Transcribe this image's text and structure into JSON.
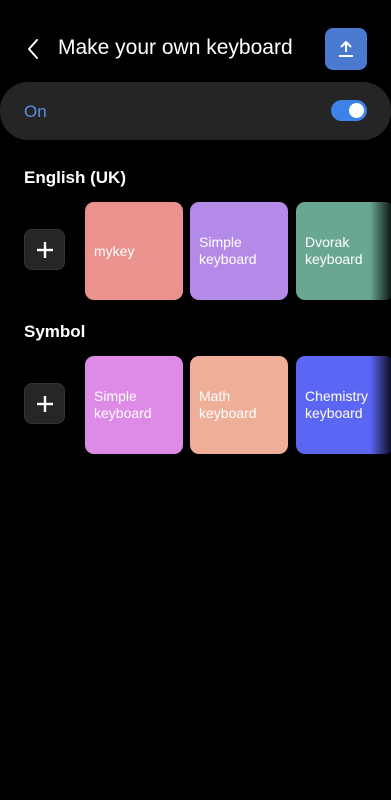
{
  "header": {
    "title": "Make your own keyboard"
  },
  "toggle": {
    "label": "On",
    "state": "on"
  },
  "sections": [
    {
      "title": "English (UK)",
      "cards": [
        {
          "label": "mykey",
          "color": "#eb928f"
        },
        {
          "label": "Simple\nkeyboard",
          "color": "#b48ae8"
        },
        {
          "label": "Dvorak\nkeyboard",
          "color": "#6aa793"
        }
      ]
    },
    {
      "title": "Symbol",
      "cards": [
        {
          "label": "Simple\nkeyboard",
          "color": "#de8ae7"
        },
        {
          "label": "Math\nkeyboard",
          "color": "#efae97"
        },
        {
          "label": "Chemistry\nkeyboard",
          "color": "#5c66f4"
        }
      ]
    }
  ],
  "colors": {
    "accent": "#3d82e6",
    "share_button": "#4b7ad1",
    "background": "#000000"
  }
}
